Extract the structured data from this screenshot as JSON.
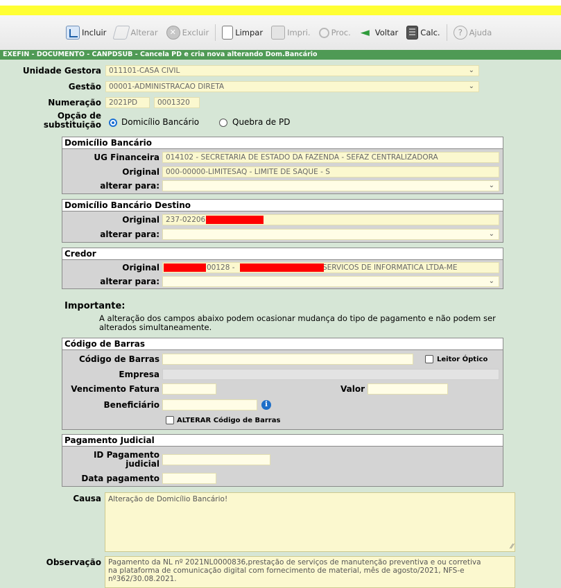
{
  "toolbar": {
    "incluir": "Incluir",
    "alterar": "Alterar",
    "excluir": "Excluir",
    "limpar": "Limpar",
    "impri": "Impri.",
    "proc": "Proc.",
    "voltar": "Voltar",
    "calc": "Calc.",
    "ajuda": "Ajuda"
  },
  "title": "EXEFIN - DOCUMENTO - CANPDSUB - Cancela PD e cria nova alterando Dom.Bancário",
  "form": {
    "unidade_gestora_label": "Unidade Gestora",
    "unidade_gestora_value": "011101-CASA CIVIL",
    "gestao_label": "Gestão",
    "gestao_value": "00001-ADMINISTRACAO DIRETA",
    "numeracao_label": "Numeração",
    "numeracao_ano": "2021PD",
    "numeracao_num": "0001320",
    "opcao_label_1": "Opção de",
    "opcao_label_2": "substituição",
    "opcao_1": "Domicílio Bancário",
    "opcao_2": "Quebra de PD"
  },
  "domicilio": {
    "header": "Domicílio Bancário",
    "ug_fin_label": "UG Financeira",
    "ug_fin_value": "014102 - SECRETARIA DE ESTADO DA FAZENDA - SEFAZ  CENTRALIZADORA",
    "original_label": "Original",
    "original_value": "000-00000-LIMITESAQ - LIMITE DE SAQUE - S",
    "alterar_label": "alterar para:"
  },
  "destino": {
    "header": "Domicílio Bancário Destino",
    "original_label": "Original",
    "original_value": "237-02206",
    "alterar_label": "alterar para:"
  },
  "credor": {
    "header": "Credor",
    "original_label": "Original",
    "original_mid": "00128 -",
    "original_tail": "SERVICOS DE INFORMATICA LTDA-ME",
    "alterar_label": "alterar para:"
  },
  "importante": {
    "title": "Importante:",
    "line1": "A alteração dos campos abaixo podem ocasionar mudança do tipo de pagamento e não podem ser",
    "line2": "alterados simultaneamente."
  },
  "barras": {
    "header": "Código de Barras",
    "codigo_label": "Código de Barras",
    "leitor_label": "Leitor Óptico",
    "empresa_label": "Empresa",
    "vencimento_label": "Vencimento Fatura",
    "valor_label": "Valor",
    "beneficiario_label": "Beneficiário",
    "alterar_label": "ALTERAR Código de Barras"
  },
  "judicial": {
    "header": "Pagamento Judicial",
    "id_label_1": "ID Pagamento",
    "id_label_2": "judicial",
    "data_label": "Data pagamento"
  },
  "causa": {
    "label": "Causa",
    "value": "Alteração de Domicílio Bancário!"
  },
  "observacao": {
    "label": "Observação",
    "line1": "Pagamento da NL nº 2021NL0000836,prestação de serviços de manutenção preventiva e ou corretiva",
    "line2": "na plataforma de comunicação digital com fornecimento de material, mês de  agosto/2021, NFS-e",
    "line3": "nº362/30.08.2021."
  }
}
